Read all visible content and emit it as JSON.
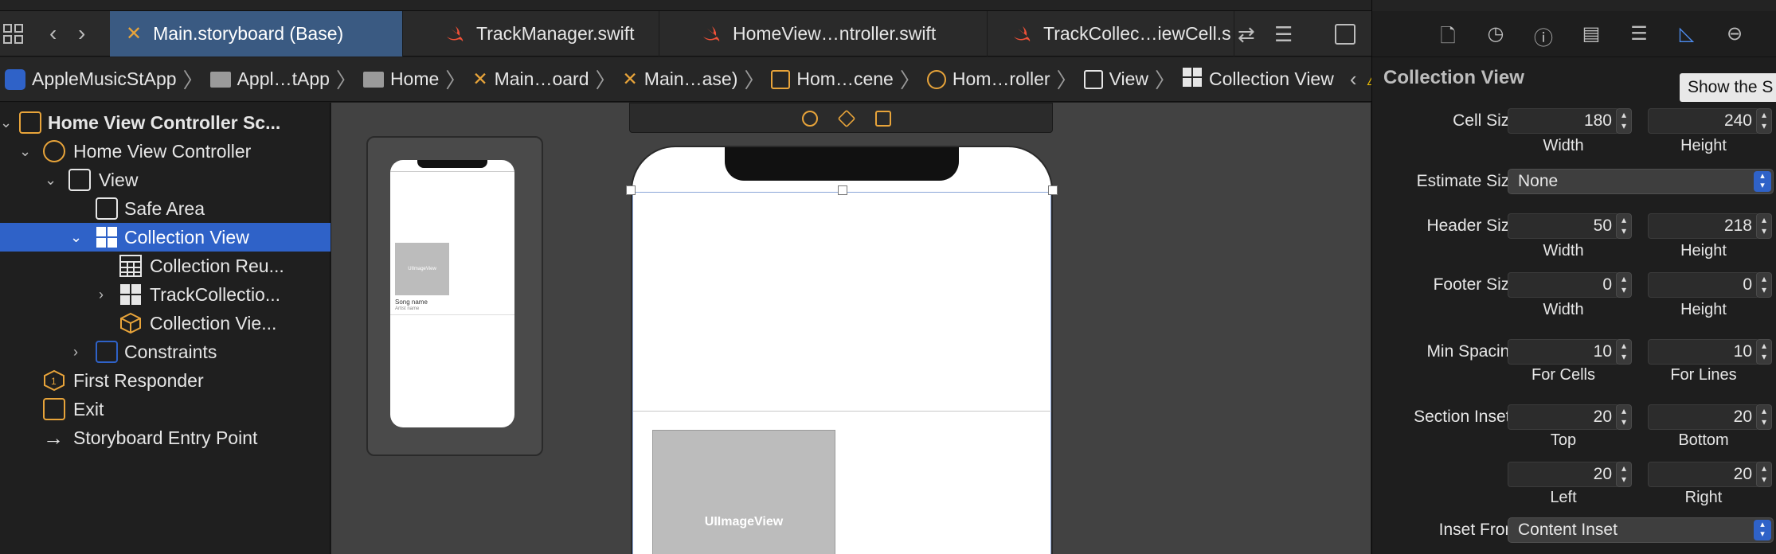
{
  "tabs": [
    {
      "label": "Main.storyboard (Base)",
      "active": true
    },
    {
      "label": "TrackManager.swift",
      "active": false
    },
    {
      "label": "HomeView…ntroller.swift",
      "active": false
    },
    {
      "label": "TrackCollec…iewCell.s",
      "active": false
    }
  ],
  "breadcrumbs": [
    "AppleMusicStApp",
    "Appl…tApp",
    "Home",
    "Main…oard",
    "Main…ase)",
    "Hom…cene",
    "Hom…roller",
    "View",
    "Collection View"
  ],
  "outline": {
    "items": [
      {
        "label": "Home View Controller Sc...",
        "icon": "scene-icon"
      },
      {
        "label": "Home View Controller",
        "icon": "view-controller-icon"
      },
      {
        "label": "View",
        "icon": "view-icon"
      },
      {
        "label": "Safe Area",
        "icon": "safe-area-icon"
      },
      {
        "label": "Collection View",
        "icon": "collection-view-icon"
      },
      {
        "label": "Collection Reu...",
        "icon": "reusable-view-icon"
      },
      {
        "label": "TrackCollectio...",
        "icon": "collection-cell-icon"
      },
      {
        "label": "Collection Vie...",
        "icon": "cube-icon"
      },
      {
        "label": "Constraints",
        "icon": "constraints-icon"
      },
      {
        "label": "First Responder",
        "icon": "first-responder-icon"
      },
      {
        "label": "Exit",
        "icon": "exit-icon"
      },
      {
        "label": "Storyboard Entry Point",
        "icon": "arrow-right-icon"
      }
    ]
  },
  "canvas": {
    "image_view_label": "UIImageView",
    "mini_image_label": "UIImageView",
    "mini_song_label": "Song name",
    "mini_artist_label": "Artist name"
  },
  "inspector": {
    "title": "Collection View",
    "tooltip": "Show the S",
    "cell_size": {
      "label": "Cell Size",
      "width": "180",
      "height": "240",
      "width_label": "Width",
      "height_label": "Height"
    },
    "estimate_size": {
      "label": "Estimate Size",
      "value": "None"
    },
    "header_size": {
      "label": "Header Size",
      "width": "50",
      "height": "218",
      "width_label": "Width",
      "height_label": "Height"
    },
    "footer_size": {
      "label": "Footer Size",
      "width": "0",
      "height": "0",
      "width_label": "Width",
      "height_label": "Height"
    },
    "min_spacing": {
      "label": "Min Spacing",
      "cells": "10",
      "lines": "10",
      "cells_label": "For Cells",
      "lines_label": "For Lines"
    },
    "section_insets": {
      "label": "Section Insets",
      "top": "20",
      "bottom": "20",
      "left": "20",
      "right": "20",
      "top_label": "Top",
      "bottom_label": "Bottom",
      "left_label": "Left",
      "right_label": "Right"
    },
    "inset_from": {
      "label": "Inset From",
      "value": "Content Inset"
    }
  },
  "colors": {
    "accent": "#2f62c8",
    "swift": "#f05138",
    "warning": "#f5c400",
    "storyboard": "#e8a43a"
  }
}
